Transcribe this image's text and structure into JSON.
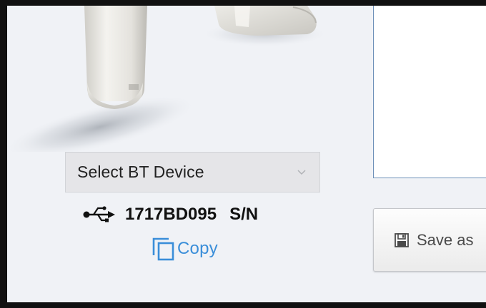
{
  "bt_device_select": {
    "selected_value": "Select BT Device",
    "chevron_icon": "chevron-down-icon"
  },
  "device_info": {
    "connection_icon": "usb-icon",
    "serial_number": "1717BD095",
    "serial_label": "S/N"
  },
  "copy_action": {
    "icon": "copy-icon",
    "label": "Copy",
    "color": "#3a8ed9"
  },
  "save_action": {
    "icon": "save-icon",
    "label": "Save as"
  },
  "colors": {
    "window_background": "#f0f2f6",
    "panel_border": "#6c8fb8",
    "link": "#3a8ed9"
  }
}
